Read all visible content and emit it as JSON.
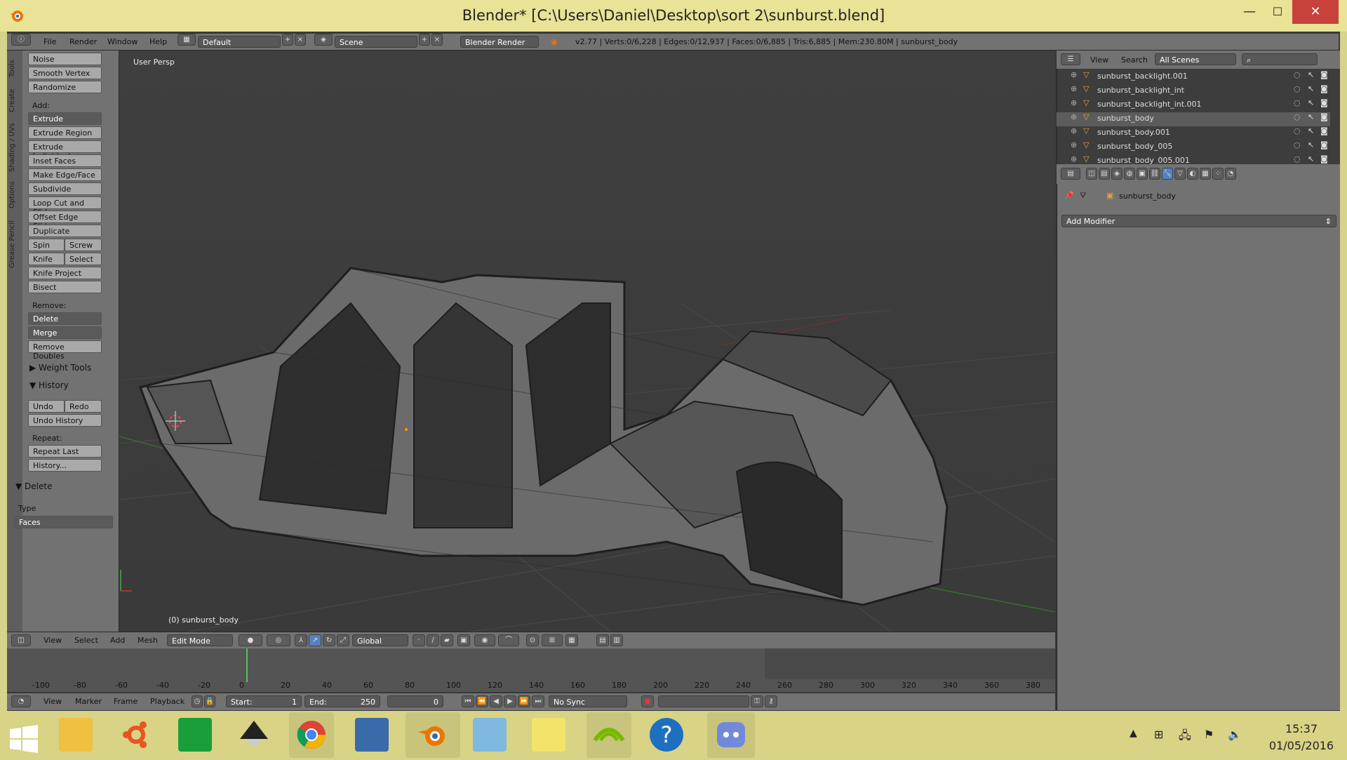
{
  "window": {
    "title": "Blender* [C:\\Users\\Daniel\\Desktop\\sort 2\\sunburst.blend]",
    "minimize": "—",
    "maximize": "☐",
    "close": "✕"
  },
  "info_header": {
    "menus": [
      "File",
      "Render",
      "Window",
      "Help"
    ],
    "layout": "Default",
    "scene": "Scene",
    "engine": "Blender Render",
    "stats": "v2.77 | Verts:0/6,228 | Edges:0/12,937 | Faces:0/6,885 | Tris:6,885 | Mem:230.80M | sunburst_body"
  },
  "toolshelf": {
    "tabs": [
      "Tools",
      "Create",
      "Shading / UVs",
      "Options",
      "Grease Pencil"
    ],
    "top_buttons": [
      "Noise",
      "Smooth Vertex",
      "Randomize"
    ],
    "add_label": "Add:",
    "add_buttons": [
      "Extrude",
      "Extrude Region",
      "Extrude Individual",
      "Inset Faces",
      "Make Edge/Face",
      "Subdivide",
      "Loop Cut and Slide",
      "Offset Edge Slide",
      "Duplicate"
    ],
    "spin": "Spin",
    "screw": "Screw",
    "knife": "Knife",
    "select": "Select",
    "knife_project": "Knife Project",
    "bisect": "Bisect",
    "remove_label": "Remove:",
    "delete": "Delete",
    "merge": "Merge",
    "remove_doubles": "Remove Doubles",
    "weight_tools": "Weight Tools",
    "history": "History",
    "undo": "Undo",
    "redo": "Redo",
    "undo_history": "Undo History",
    "repeat_label": "Repeat:",
    "repeat_last": "Repeat Last",
    "history_btn": "History...",
    "op_panel": "Delete",
    "type_label": "Type",
    "type_value": "Faces"
  },
  "viewport": {
    "persp": "User Persp",
    "object": "(0) sunburst_body"
  },
  "viewport_header": {
    "menus": [
      "View",
      "Select",
      "Add",
      "Mesh"
    ],
    "mode": "Edit Mode",
    "orientation": "Global"
  },
  "timeline": {
    "ticks": [
      "-100",
      "-80",
      "-60",
      "-40",
      "-20",
      "0",
      "20",
      "40",
      "60",
      "80",
      "100",
      "120",
      "140",
      "160",
      "180",
      "200",
      "220",
      "240",
      "260",
      "280",
      "300",
      "320",
      "340",
      "360",
      "380"
    ],
    "menus": [
      "View",
      "Marker",
      "Frame",
      "Playback"
    ],
    "start": "Start:",
    "start_val": "1",
    "end": "End:",
    "end_val": "250",
    "current": "0",
    "sync": "No Sync"
  },
  "outliner": {
    "view": "View",
    "search": "Search",
    "scenes": "All Scenes",
    "items": [
      "sunburst_backlight.001",
      "sunburst_backlight_int",
      "sunburst_backlight_int.001",
      "sunburst_body",
      "sunburst_body.001",
      "sunburst_body_005",
      "sunburst_body_005.001"
    ]
  },
  "properties": {
    "object": "sunburst_body",
    "add_modifier": "Add Modifier"
  },
  "taskbar": {
    "time": "15:37",
    "date": "01/05/2016"
  },
  "colors": {
    "titlebar": "#e8e396",
    "panel": "#727272",
    "viewport": "#3d3d3d",
    "selection": "#5a5a5a",
    "close": "#c8413a",
    "playhead": "#55c255"
  }
}
